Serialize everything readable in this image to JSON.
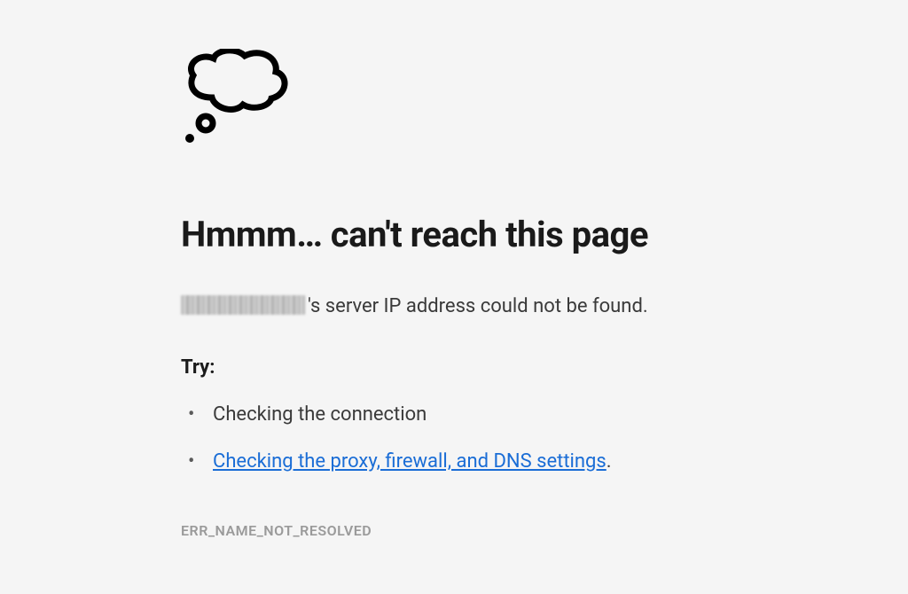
{
  "heading": "Hmmm… can't reach this page",
  "description_suffix": "'s server IP address could not be found.",
  "try_label": "Try:",
  "suggestions": {
    "item1": "Checking the connection",
    "item2_link": "Checking the proxy, firewall, and DNS settings",
    "item2_suffix": "."
  },
  "error_code": "ERR_NAME_NOT_RESOLVED"
}
